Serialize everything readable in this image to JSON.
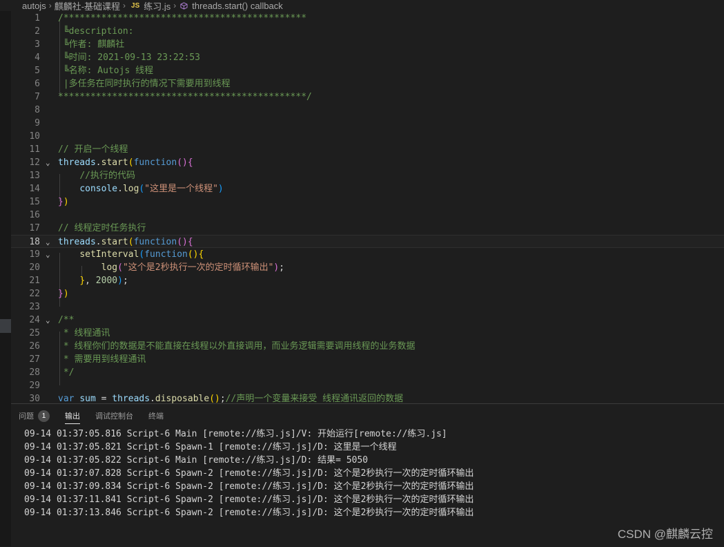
{
  "breadcrumb": {
    "folder": "autojs",
    "course": "麒麟社-基础课程",
    "file_icon": "JS",
    "file": "练习.js",
    "symbol_icon": "cube-icon",
    "symbol": "threads.start() callback"
  },
  "editor": {
    "lines": [
      {
        "n": "1",
        "t": [
          [
            "cm",
            "/*********************************************"
          ]
        ]
      },
      {
        "n": "2",
        "t": [
          [
            "cm",
            " ╚description:"
          ]
        ]
      },
      {
        "n": "3",
        "t": [
          [
            "cm",
            " ╚作者: 麒麟社"
          ]
        ]
      },
      {
        "n": "4",
        "t": [
          [
            "cm",
            " ╚时间: 2021-09-13 23:22:53"
          ]
        ]
      },
      {
        "n": "5",
        "t": [
          [
            "cm",
            " ╚名称: Autojs 线程"
          ]
        ]
      },
      {
        "n": "6",
        "t": [
          [
            "cm",
            " |多任务在同时执行的情况下需要用到线程"
          ]
        ]
      },
      {
        "n": "7",
        "t": [
          [
            "cm",
            "**********************************************/"
          ]
        ]
      },
      {
        "n": "8",
        "t": []
      },
      {
        "n": "9",
        "t": []
      },
      {
        "n": "10",
        "t": []
      },
      {
        "n": "11",
        "t": [
          [
            "cm",
            "// 开启一个线程"
          ]
        ]
      },
      {
        "n": "12",
        "fold": "⌄",
        "t": [
          [
            "var",
            "threads"
          ],
          [
            "pl",
            "."
          ],
          [
            "fn",
            "start"
          ],
          [
            "br1",
            "("
          ],
          [
            "kw",
            "function"
          ],
          [
            "br2",
            "()"
          ],
          [
            "br2",
            "{"
          ]
        ]
      },
      {
        "n": "13",
        "t": [
          [
            "pl",
            "    "
          ],
          [
            "cm",
            "//执行的代码"
          ]
        ]
      },
      {
        "n": "14",
        "t": [
          [
            "pl",
            "    "
          ],
          [
            "var",
            "console"
          ],
          [
            "pl",
            "."
          ],
          [
            "fn",
            "log"
          ],
          [
            "br3",
            "("
          ],
          [
            "str",
            "\"这里是一个线程\""
          ],
          [
            "br3",
            ")"
          ]
        ]
      },
      {
        "n": "15",
        "t": [
          [
            "br2",
            "}"
          ],
          [
            "br1",
            ")"
          ]
        ]
      },
      {
        "n": "16",
        "t": []
      },
      {
        "n": "17",
        "t": [
          [
            "cm",
            "// 线程定时任务执行"
          ]
        ]
      },
      {
        "n": "18",
        "fold": "⌄",
        "active": true,
        "t": [
          [
            "var",
            "threads"
          ],
          [
            "pl",
            "."
          ],
          [
            "fn",
            "start"
          ],
          [
            "br1",
            "("
          ],
          [
            "kw",
            "function"
          ],
          [
            "br2",
            "()"
          ],
          [
            "br2",
            "{"
          ]
        ]
      },
      {
        "n": "19",
        "fold": "⌄",
        "t": [
          [
            "pl",
            "    "
          ],
          [
            "fn",
            "setInterval"
          ],
          [
            "br3",
            "("
          ],
          [
            "kw",
            "function"
          ],
          [
            "br1",
            "()"
          ],
          [
            "br1",
            "{"
          ]
        ]
      },
      {
        "n": "20",
        "t": [
          [
            "pl",
            "        "
          ],
          [
            "fn",
            "log"
          ],
          [
            "br2",
            "("
          ],
          [
            "str",
            "\"这个是2秒执行一次的定时循环输出\""
          ],
          [
            "br2",
            ")"
          ],
          [
            "pl",
            ";"
          ]
        ]
      },
      {
        "n": "21",
        "t": [
          [
            "pl",
            "    "
          ],
          [
            "br1",
            "}"
          ],
          [
            "pl",
            ", "
          ],
          [
            "num",
            "2000"
          ],
          [
            "br3",
            ")"
          ],
          [
            "pl",
            ";"
          ]
        ]
      },
      {
        "n": "22",
        "t": [
          [
            "br2",
            "}"
          ],
          [
            "br1",
            ")"
          ]
        ]
      },
      {
        "n": "23",
        "t": []
      },
      {
        "n": "24",
        "fold": "⌄",
        "t": [
          [
            "cm",
            "/**"
          ]
        ]
      },
      {
        "n": "25",
        "t": [
          [
            "cm",
            " * 线程通讯"
          ]
        ]
      },
      {
        "n": "26",
        "t": [
          [
            "cm",
            " * 线程你们的数据是不能直接在线程以外直接调用，而业务逻辑需要调用线程的业务数据"
          ]
        ]
      },
      {
        "n": "27",
        "t": [
          [
            "cm",
            " * 需要用到线程通讯"
          ]
        ]
      },
      {
        "n": "28",
        "t": [
          [
            "cm",
            " */"
          ]
        ]
      },
      {
        "n": "29",
        "t": []
      },
      {
        "n": "30",
        "t": [
          [
            "kw",
            "var"
          ],
          [
            "pl",
            " "
          ],
          [
            "var",
            "sum"
          ],
          [
            "pl",
            " = "
          ],
          [
            "var",
            "threads"
          ],
          [
            "pl",
            "."
          ],
          [
            "fn",
            "disposable"
          ],
          [
            "br1",
            "()"
          ],
          [
            "pl",
            ";"
          ],
          [
            "cm",
            "//声明一个变量来接受 线程通讯返回的数据"
          ]
        ]
      }
    ]
  },
  "panel": {
    "tabs": [
      {
        "label": "问题",
        "badge": "1"
      },
      {
        "label": "输出",
        "active": true
      },
      {
        "label": "调试控制台"
      },
      {
        "label": "终端"
      }
    ],
    "output": [
      "09-14 01:37:05.816 Script-6 Main [remote://练习.js]/V: 开始运行[remote://练习.js]",
      "09-14 01:37:05.821 Script-6 Spawn-1 [remote://练习.js]/D: 这里是一个线程",
      "09-14 01:37:05.822 Script-6 Main [remote://练习.js]/D: 结果= 5050",
      "09-14 01:37:07.828 Script-6 Spawn-2 [remote://练习.js]/D: 这个是2秒执行一次的定时循环输出",
      "09-14 01:37:09.834 Script-6 Spawn-2 [remote://练习.js]/D: 这个是2秒执行一次的定时循环输出",
      "09-14 01:37:11.841 Script-6 Spawn-2 [remote://练习.js]/D: 这个是2秒执行一次的定时循环输出",
      "09-14 01:37:13.846 Script-6 Spawn-2 [remote://练习.js]/D: 这个是2秒执行一次的定时循环输出"
    ]
  },
  "watermark": "CSDN @麒麟云控"
}
